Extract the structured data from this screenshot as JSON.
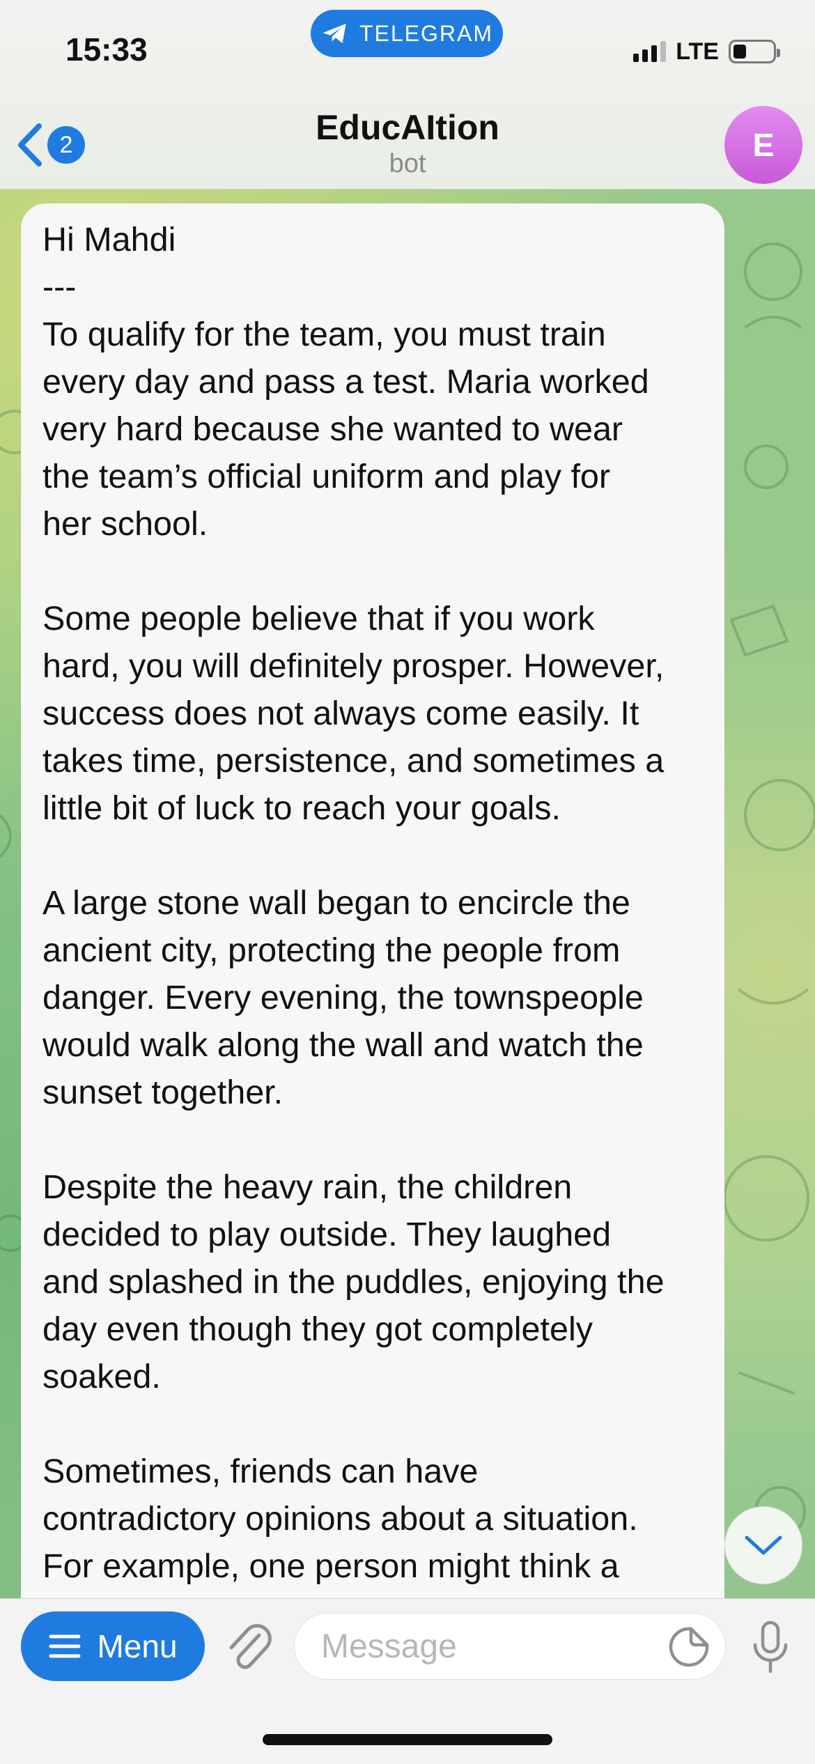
{
  "status_bar": {
    "time": "15:33",
    "app_pill": "TELEGRAM",
    "network": "LTE"
  },
  "header": {
    "unread_count": "2",
    "title": "EducAItion",
    "subtitle": "bot",
    "avatar_letter": "E"
  },
  "message": {
    "lines": [
      "Hi Mahdi",
      "---",
      "To qualify for the team, you must train",
      "every day and pass a test. Maria worked",
      "very hard because she wanted to wear",
      "the team’s official uniform and play for",
      "her school.",
      "",
      "Some people believe that if you work",
      "hard, you will definitely prosper. However,",
      "success does not always come easily. It",
      "takes time, persistence, and sometimes a",
      "little bit of luck to reach your goals.",
      "",
      "A large stone wall began to encircle the",
      "ancient city, protecting the people from",
      "danger. Every evening, the townspeople",
      "would walk along the wall and watch the",
      "sunset together.",
      "",
      "Despite the heavy rain, the children",
      "decided to play outside. They laughed",
      "and splashed in the puddles, enjoying the",
      "day even though they got completely",
      "soaked.",
      "",
      "Sometimes, friends can have",
      "contradictory opinions about a situation.",
      "For example, one person might think a"
    ]
  },
  "input_bar": {
    "menu_label": "Menu",
    "message_placeholder": "Message"
  },
  "colors": {
    "accent": "#1f7be0",
    "avatar": "#d46fe4",
    "bubble": "#f7f7f7"
  }
}
